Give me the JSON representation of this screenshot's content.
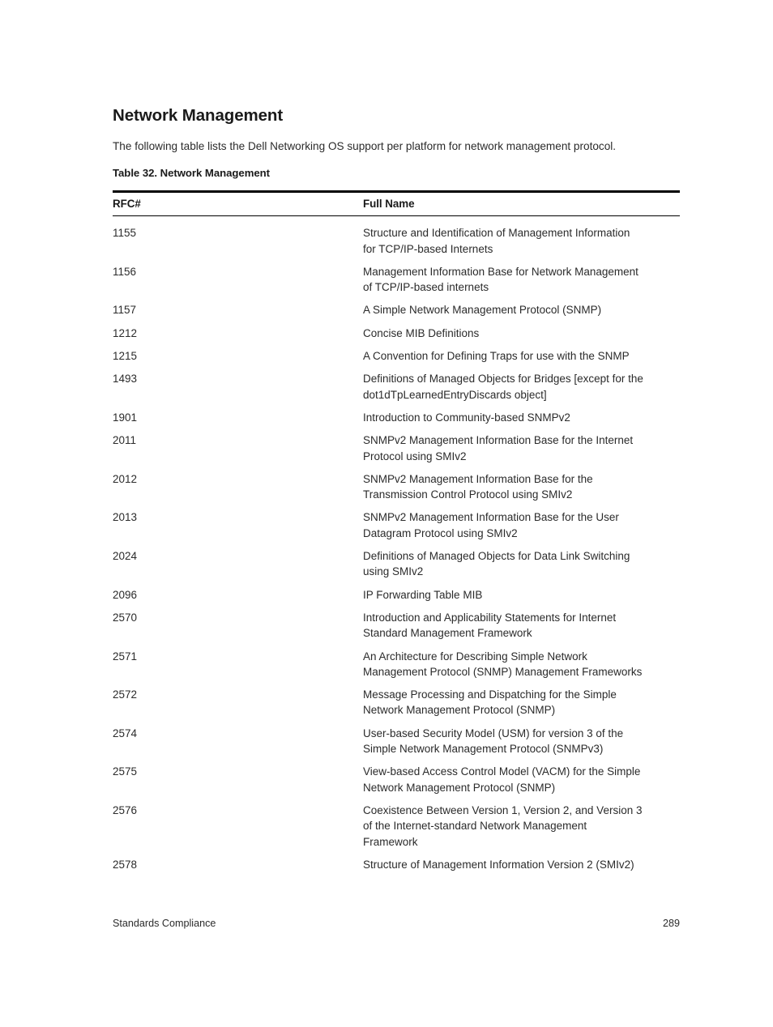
{
  "document": {
    "title": "Network Management",
    "intro": "The following table lists the Dell Networking OS support per platform for network management protocol.",
    "table_caption": "Table 32. Network Management"
  },
  "table": {
    "columns": [
      {
        "key": "rfc",
        "label": "RFC#"
      },
      {
        "key": "full_name",
        "label": "Full Name"
      }
    ],
    "rows": [
      {
        "rfc": "1155",
        "full_name": "Structure and Identification of Management Information for TCP/IP-based Internets",
        "lines": [
          "Structure and Identification of Management Information",
          "for TCP/IP-based Internets"
        ]
      },
      {
        "rfc": "1156",
        "full_name": "Management Information Base for Network Management of TCP/IP-based internets",
        "lines": [
          "Management Information Base for Network Management",
          "of TCP/IP-based internets"
        ]
      },
      {
        "rfc": "1157",
        "full_name": "A Simple Network Management Protocol (SNMP)",
        "lines": [
          "A Simple Network Management Protocol (SNMP)"
        ]
      },
      {
        "rfc": "1212",
        "full_name": "Concise MIB Definitions",
        "lines": [
          "Concise MIB Definitions"
        ]
      },
      {
        "rfc": "1215",
        "full_name": "A Convention for Defining Traps for use with the SNMP",
        "lines": [
          "A Convention for Defining Traps for use with the SNMP"
        ]
      },
      {
        "rfc": "1493",
        "full_name": "Definitions of Managed Objects for Bridges [except for the dot1dTpLearnedEntryDiscards object]",
        "lines": [
          "Definitions of Managed Objects for Bridges [except for the",
          "dot1dTpLearnedEntryDiscards object]"
        ]
      },
      {
        "rfc": "1901",
        "full_name": "Introduction to Community-based SNMPv2",
        "lines": [
          "Introduction to Community-based SNMPv2"
        ]
      },
      {
        "rfc": "2011",
        "full_name": "SNMPv2 Management Information Base for the Internet Protocol using SMIv2",
        "lines": [
          "SNMPv2 Management Information Base for the Internet",
          "Protocol using SMIv2"
        ]
      },
      {
        "rfc": "2012",
        "full_name": "SNMPv2 Management Information Base for the Transmission Control Protocol using SMIv2",
        "lines": [
          "SNMPv2 Management Information Base for the",
          "Transmission Control Protocol using SMIv2"
        ]
      },
      {
        "rfc": "2013",
        "full_name": "SNMPv2 Management Information Base for the User Datagram Protocol using SMIv2",
        "lines": [
          "SNMPv2 Management Information Base for the User",
          "Datagram Protocol using SMIv2"
        ]
      },
      {
        "rfc": "2024",
        "full_name": "Definitions of Managed Objects for Data Link Switching using SMIv2",
        "lines": [
          "Definitions of Managed Objects for Data Link Switching",
          "using SMIv2"
        ]
      },
      {
        "rfc": "2096",
        "full_name": "IP Forwarding Table MIB",
        "lines": [
          "IP Forwarding Table MIB"
        ]
      },
      {
        "rfc": "2570",
        "full_name": "Introduction and Applicability Statements for Internet Standard Management Framework",
        "lines": [
          "Introduction and Applicability Statements for Internet",
          "Standard Management Framework"
        ]
      },
      {
        "rfc": "2571",
        "full_name": "An Architecture for Describing Simple Network Management Protocol (SNMP) Management Frameworks",
        "lines": [
          "An Architecture for Describing Simple Network",
          "Management Protocol (SNMP) Management Frameworks"
        ]
      },
      {
        "rfc": "2572",
        "full_name": "Message Processing and Dispatching for the Simple Network Management Protocol (SNMP)",
        "lines": [
          "Message Processing and Dispatching for the Simple",
          "Network Management Protocol (SNMP)"
        ]
      },
      {
        "rfc": "2574",
        "full_name": "User-based Security Model (USM) for version 3 of the Simple Network Management Protocol (SNMPv3)",
        "lines": [
          "User-based Security Model (USM) for version 3 of the",
          "Simple Network Management Protocol (SNMPv3)"
        ]
      },
      {
        "rfc": "2575",
        "full_name": "View-based Access Control Model (VACM) for the Simple Network Management Protocol (SNMP)",
        "lines": [
          "View-based Access Control Model (VACM) for the Simple",
          "Network Management Protocol (SNMP)"
        ]
      },
      {
        "rfc": "2576",
        "full_name": "Coexistence Between Version 1, Version 2, and Version 3 of the Internet-standard Network Management Framework",
        "lines": [
          "Coexistence Between Version 1, Version 2, and Version 3",
          "of the Internet-standard Network Management",
          "Framework"
        ]
      },
      {
        "rfc": "2578",
        "full_name": "Structure of Management Information Version 2 (SMIv2)",
        "lines": [
          "Structure of Management Information Version 2 (SMIv2)"
        ]
      }
    ]
  },
  "footer": {
    "chapter": "Standards Compliance",
    "page_number": "289"
  },
  "colors": {
    "text": "#2b2b2b",
    "heading": "#1a1a1a",
    "rule": "#000000",
    "background": "#ffffff"
  }
}
